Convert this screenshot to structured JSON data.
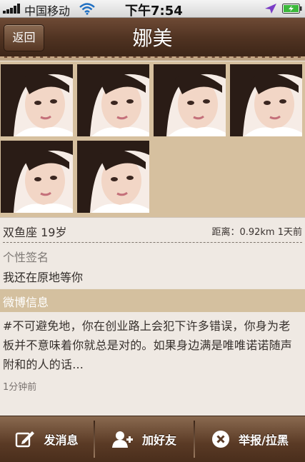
{
  "status": {
    "carrier": "中国移动",
    "time": "下午7:54"
  },
  "nav": {
    "back_label": "返回",
    "title": "娜美"
  },
  "photos": [
    {
      "icon": "profile-photo"
    },
    {
      "icon": "profile-photo"
    },
    {
      "icon": "profile-photo"
    },
    {
      "icon": "profile-photo"
    },
    {
      "icon": "profile-photo"
    },
    {
      "icon": "profile-photo"
    }
  ],
  "profile": {
    "zodiac_age": "双鱼座 19岁",
    "distance": "距离：0.92km 1天前",
    "signature_label": "个性签名",
    "signature": "我还在原地等你"
  },
  "weibo": {
    "header": "微博信息",
    "text": "#不可避免地，你在创业路上会犯下许多错误，你身为老板并不意味着你就总是对的。如果身边满是唯唯诺诺随声附和的人的话...",
    "time": "1分钟前"
  },
  "toolbar": {
    "message_label": "发消息",
    "add_friend_label": "加好友",
    "report_label": "举报/拉黑"
  },
  "colors": {
    "nav_brown": "#4f3221",
    "photo_bg": "#d6c09f",
    "section_bg": "#efe9e3"
  }
}
